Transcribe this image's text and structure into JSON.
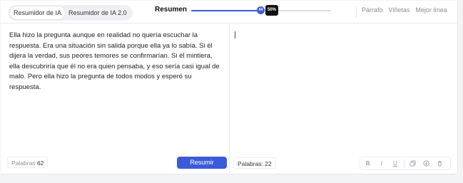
{
  "mode_tabs": [
    {
      "label": "Resumidor de IA"
    },
    {
      "label": "Resumidor de IA 2.0"
    }
  ],
  "summary": {
    "label": "Resumen",
    "thumb_label": "64",
    "percent_label": "50%",
    "level": 0.5
  },
  "view_tabs": [
    {
      "label": "Párrafo"
    },
    {
      "label": "Viñetas"
    },
    {
      "label": "Mejor línea"
    }
  ],
  "input": {
    "text": "Ella hizo la pregunta aunque en realidad no quería escuchar la respuesta. Era una situación sin salida porque ella ya lo sabía. Si él dijera la verdad, sus peores temores se confirmarían. Si él mintiera, ella descubriría que él no era quien pensaba, y eso sería casi igual de malo. Pero ella hizo la pregunta de todos modos y esperó su respuesta.",
    "words_label": "Palabras",
    "words_count": "62"
  },
  "actions": {
    "summarize_label": "Resumir"
  },
  "output": {
    "words_label": "Palabras:",
    "words_count": "22"
  },
  "toolbar": {
    "bold_label": "B",
    "italic_label": "I",
    "underline_label": "U"
  },
  "colors": {
    "accent": "#3b5bdb",
    "tooltip": "#111111"
  }
}
